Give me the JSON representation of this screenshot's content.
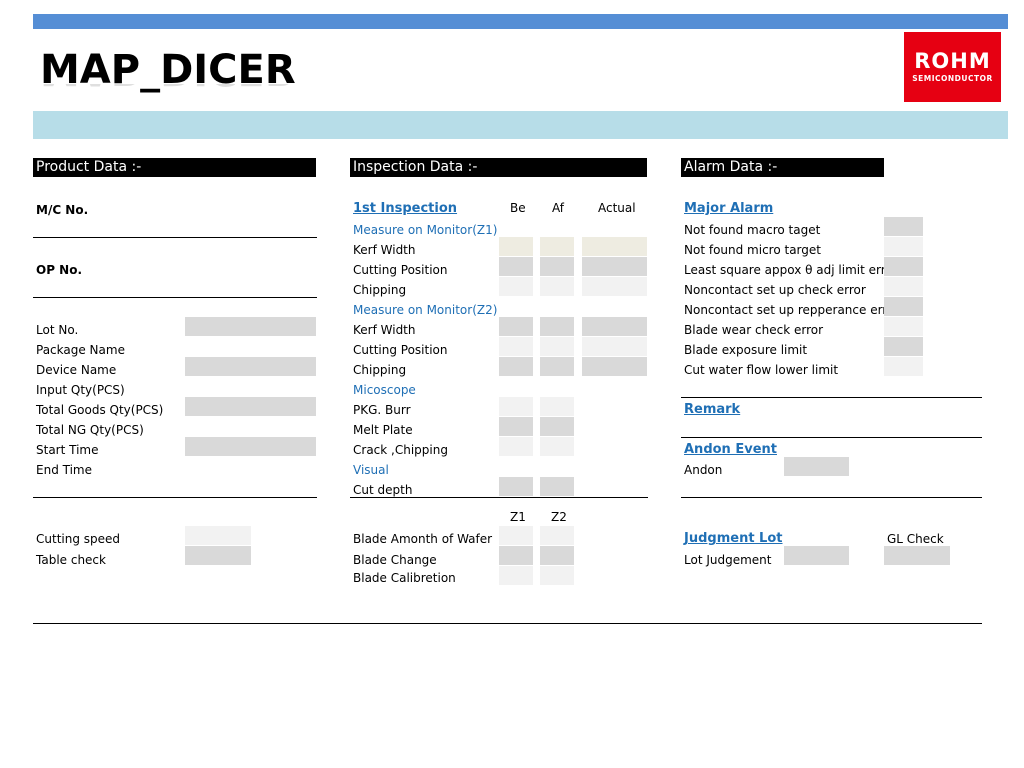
{
  "header": {
    "title": "MAP_DICER",
    "logo_main": "ROHM",
    "logo_sub": "SEMICONDUCTOR"
  },
  "product": {
    "section": "Product Data :-",
    "mc_no": "M/C No.",
    "op_no": "OP  No.",
    "lot_no": "Lot  No.",
    "package_name": "Package Name",
    "device_name": "Device Name",
    "input_qty": "Input Qty(PCS)",
    "total_goods": "Total Goods Qty(PCS)",
    "total_ng": "Total NG Qty(PCS)",
    "start_time": "Start Time",
    "end_time": "End Time",
    "cutting_speed": "Cutting speed",
    "table_check": "Table check"
  },
  "inspection": {
    "section": "Inspection Data  :-",
    "first": "1st Inspection",
    "col_be": "Be",
    "col_af": "Af",
    "col_actual": "Actual",
    "monitor_z1": "Measure on Monitor(Z1)",
    "kerf1": "Kerf Width",
    "cutpos1": "Cutting Position",
    "chip1": "Chipping",
    "monitor_z2": "Measure on Monitor(Z2)",
    "kerf2": "Kerf Width",
    "cutpos2": "Cutting Position",
    "chip2": "Chipping",
    "microscope": "Micoscope",
    "pkg_burr": "PKG. Burr",
    "melt_plate": "Melt Plate",
    "crack": "Crack ,Chipping",
    "visual": "Visual",
    "cut_depth": "Cut depth",
    "col_z1": "Z1",
    "col_z2": "Z2",
    "blade_amount": "Blade Amonth of Wafer",
    "blade_change": "Blade Change",
    "blade_cal": "Blade Calibretion"
  },
  "alarm": {
    "section": "Alarm Data  :-",
    "major": "Major Alarm",
    "items": [
      "Not found macro taget",
      "Not found micro target",
      "Least square appox θ adj limit err",
      "Noncontact set up check error",
      "Noncontact set up repperance err",
      "Blade wear check error",
      "Blade exposure limit",
      "Cut water flow lower limit"
    ],
    "remark": "Remark",
    "andon_event": "Andon Event",
    "andon": "Andon",
    "judgment_lot": "Judgment Lot",
    "gl_check": "GL Check",
    "lot_judgement": "Lot Judgement"
  }
}
